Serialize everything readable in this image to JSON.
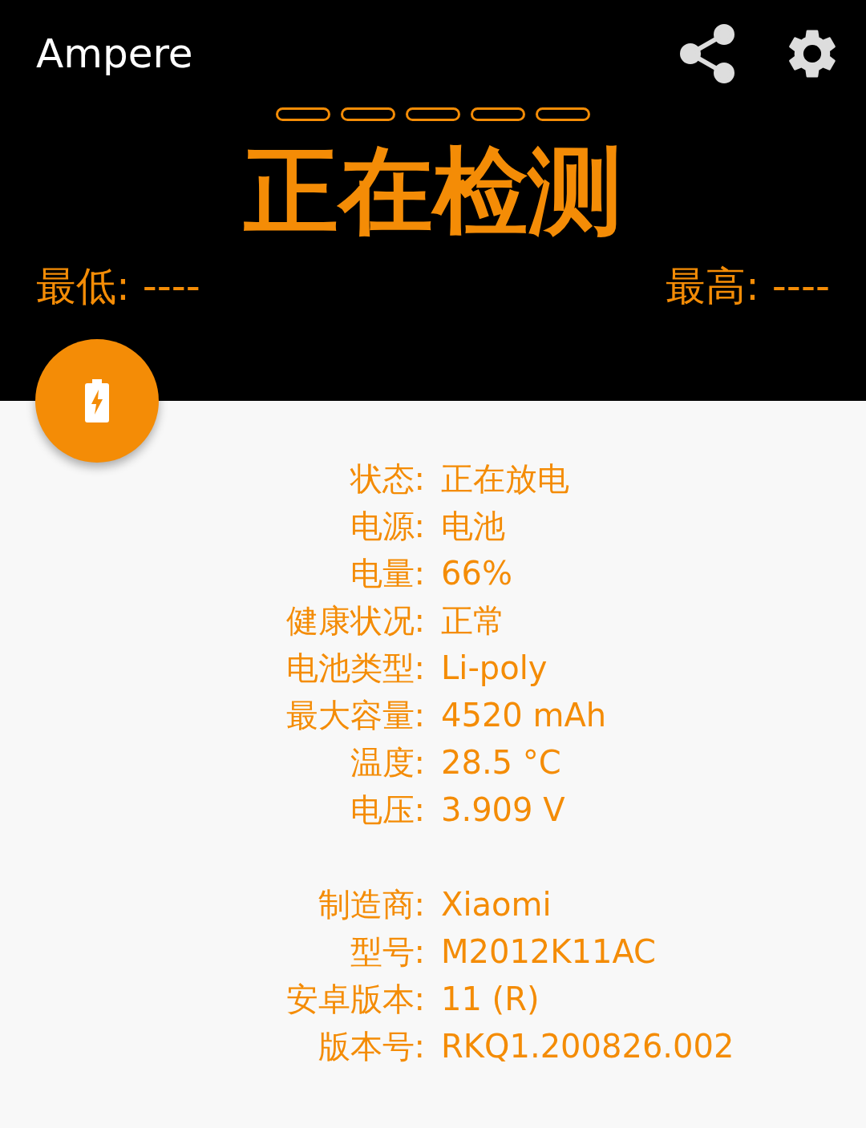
{
  "app_bar": {
    "title": "Ampere"
  },
  "meter": {
    "segments": [
      {
        "on": false
      },
      {
        "on": false
      },
      {
        "on": false
      },
      {
        "on": false
      },
      {
        "on": false
      }
    ]
  },
  "reading": {
    "status": "正在检测",
    "min_label": "最低:",
    "min_value": "----",
    "max_label": "最高:",
    "max_value": "----"
  },
  "info_groups": [
    [
      {
        "label": "状态:",
        "value": "正在放电"
      },
      {
        "label": "电源:",
        "value": "电池"
      },
      {
        "label": "电量:",
        "value": "66%"
      },
      {
        "label": "健康状况:",
        "value": "正常"
      },
      {
        "label": "电池类型:",
        "value": "Li-poly"
      },
      {
        "label": "最大容量:",
        "value": "4520 mAh"
      },
      {
        "label": "温度:",
        "value": "28.5 °C"
      },
      {
        "label": "电压:",
        "value": "3.909 V"
      }
    ],
    [
      {
        "label": "制造商:",
        "value": "Xiaomi"
      },
      {
        "label": "型号:",
        "value": "M2012K11AC"
      },
      {
        "label": "安卓版本:",
        "value": "11 (R)"
      },
      {
        "label": "版本号:",
        "value": "RKQ1.200826.002"
      }
    ]
  ]
}
